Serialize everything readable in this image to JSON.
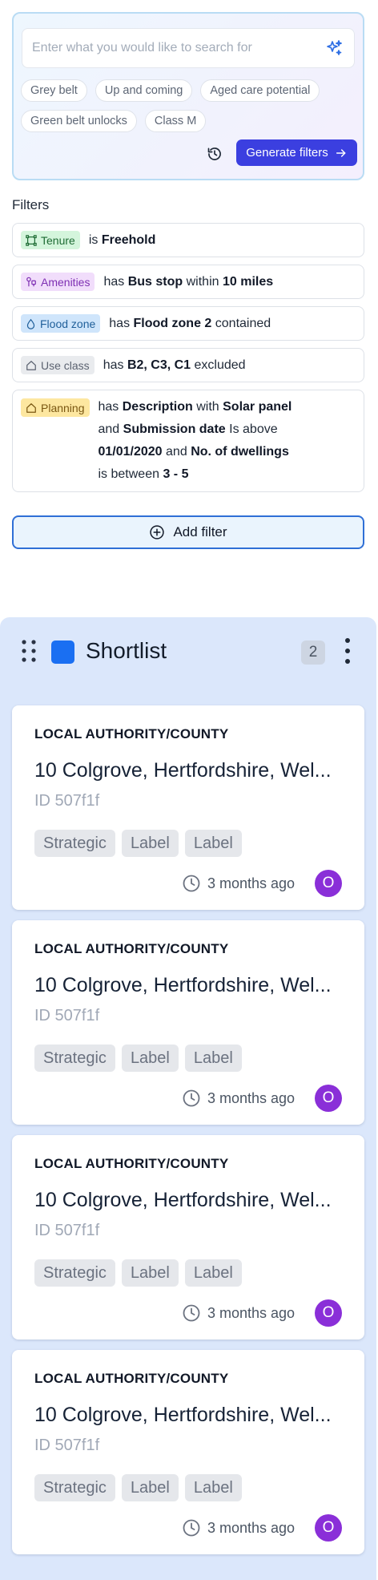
{
  "search": {
    "placeholder": "Enter what you would like to search for",
    "suggestions": [
      "Grey belt",
      "Up and coming",
      "Aged care potential",
      "Green belt unlocks",
      "Class M"
    ],
    "generate_label": "Generate filters",
    "accent_color": "#3b3fe0"
  },
  "filters": {
    "title": "Filters",
    "rows": [
      {
        "tag": "Tenure",
        "icon": "boundary-icon",
        "color": "#d4f5dc",
        "parts": {
          "p1": "is",
          "b1": "Freehold"
        }
      },
      {
        "tag": "Amenities",
        "icon": "amenities-icon",
        "color": "#f1ddfb",
        "parts": {
          "p1": "has",
          "b1": "Bus stop",
          "p2": "within",
          "b2": "10 miles"
        }
      },
      {
        "tag": "Flood zone",
        "icon": "droplet-icon",
        "color": "#cfe5fb",
        "parts": {
          "p1": "has",
          "b1": "Flood zone 2",
          "p2": "contained"
        }
      },
      {
        "tag": "Use class",
        "icon": "home-icon",
        "color": "#e9ebee",
        "parts": {
          "p1": "has",
          "b1": "B2, C3, C1",
          "p2": "excluded"
        }
      },
      {
        "tag": "Planning",
        "icon": "home-icon",
        "color": "#fde7a0",
        "parts": {
          "p1": "has",
          "b1": "Description",
          "p2": "with",
          "b2": "Solar panel",
          "p3": "and",
          "b3": "Submission date",
          "p4": "Is above",
          "b4": "01/01/2020",
          "p5": "and",
          "b5": "No. of dwellings",
          "p6": "is between",
          "b6": "3 - 5"
        }
      }
    ],
    "add_label": "Add filter"
  },
  "shortlist": {
    "title": "Shortlist",
    "count": "2",
    "color": "#1a6ff2",
    "cards": [
      {
        "authority": "LOCAL AUTHORITY/COUNTY",
        "address": "10 Colgrove, Hertfordshire, Wel...",
        "id": "ID 507f1f",
        "labels": [
          "Strategic",
          "Label",
          "Label"
        ],
        "time": "3 months ago",
        "avatar": "O"
      },
      {
        "authority": "LOCAL AUTHORITY/COUNTY",
        "address": "10 Colgrove, Hertfordshire, Wel...",
        "id": "ID 507f1f",
        "labels": [
          "Strategic",
          "Label",
          "Label"
        ],
        "time": "3 months ago",
        "avatar": "O"
      },
      {
        "authority": "LOCAL AUTHORITY/COUNTY",
        "address": "10 Colgrove, Hertfordshire, Wel...",
        "id": "ID 507f1f",
        "labels": [
          "Strategic",
          "Label",
          "Label"
        ],
        "time": "3 months ago",
        "avatar": "O"
      },
      {
        "authority": "LOCAL AUTHORITY/COUNTY",
        "address": "10 Colgrove, Hertfordshire, Wel...",
        "id": "ID 507f1f",
        "labels": [
          "Strategic",
          "Label",
          "Label"
        ],
        "time": "3 months ago",
        "avatar": "O"
      }
    ]
  }
}
